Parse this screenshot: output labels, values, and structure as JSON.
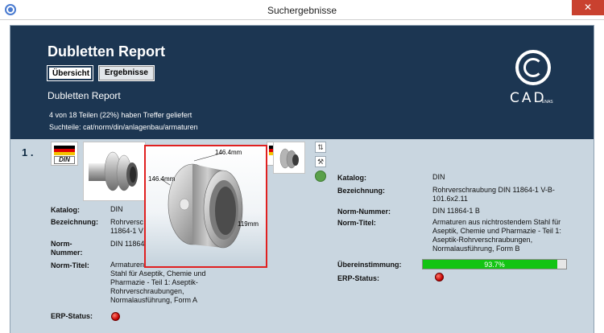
{
  "window": {
    "title": "Suchergebnisse",
    "close": "✕"
  },
  "header": {
    "title": "Dubletten Report",
    "tabs": [
      "Übersicht",
      "Ergebnisse"
    ],
    "subtitle": "Dubletten Report",
    "info_line1": "4 von 18 Teilen (22%) haben Treffer geliefert",
    "info_line2": "Suchteile: cat/norm/din/anlagenbau/armaturen",
    "logo": {
      "text": "CAD",
      "small": "ENAS"
    }
  },
  "result": {
    "number": "1 .",
    "flag_label": "DIN",
    "left": {
      "katalog_label": "Katalog:",
      "katalog": "DIN",
      "bezeichnung_label": "Bezeichnung:",
      "bezeichnung_l1": "Rohrversc",
      "bezeichnung_l2": "11864-1 V",
      "norm_nummer_label_l1": "Norm-",
      "norm_nummer_label_l2": "Nummer:",
      "norm_nummer": "DIN 11864",
      "norm_titel_label": "Norm-Titel:",
      "norm_titel": [
        "Armaturen aus nichtrostendem",
        "Stahl für Aseptik, Chemie und",
        "Pharmazie - Teil 1: Aseptik-",
        "Rohrverschraubungen,",
        "Normalausführung, Form A"
      ],
      "erp_label": "ERP-Status:"
    },
    "right": {
      "katalog_label": "Katalog:",
      "katalog": "DIN",
      "bezeichnung_label": "Bezeichnung:",
      "bezeichnung": [
        "Rohrverschraubung DIN 11864-1 V-B-",
        "101.6x2.11"
      ],
      "norm_nummer_label": "Norm-Nummer:",
      "norm_nummer": "DIN 11864-1 B",
      "norm_titel_label": "Norm-Titel:",
      "norm_titel": [
        "Armaturen aus nichtrostendem Stahl für",
        "Aseptik, Chemie und Pharmazie - Teil 1:",
        "Aseptik-Rohrverschraubungen,",
        "Normalausführung, Form B"
      ],
      "match_label": "Übereinstimmung:",
      "match_text": "93.7%",
      "match_fraction": 0.937,
      "erp_label": "ERP-Status:"
    },
    "preview_dims": {
      "top": "146.4mm",
      "left": "146.4mm",
      "right": "119mm"
    },
    "side_icons": [
      "ruler-icon",
      "wrench-icon",
      "globe-icon"
    ]
  },
  "colors": {
    "header_bg": "#1c3652",
    "panel_bg": "#c9d6e0",
    "match_green": "#13c413",
    "status_red": "#c40000",
    "highlight_red": "#e02020"
  }
}
